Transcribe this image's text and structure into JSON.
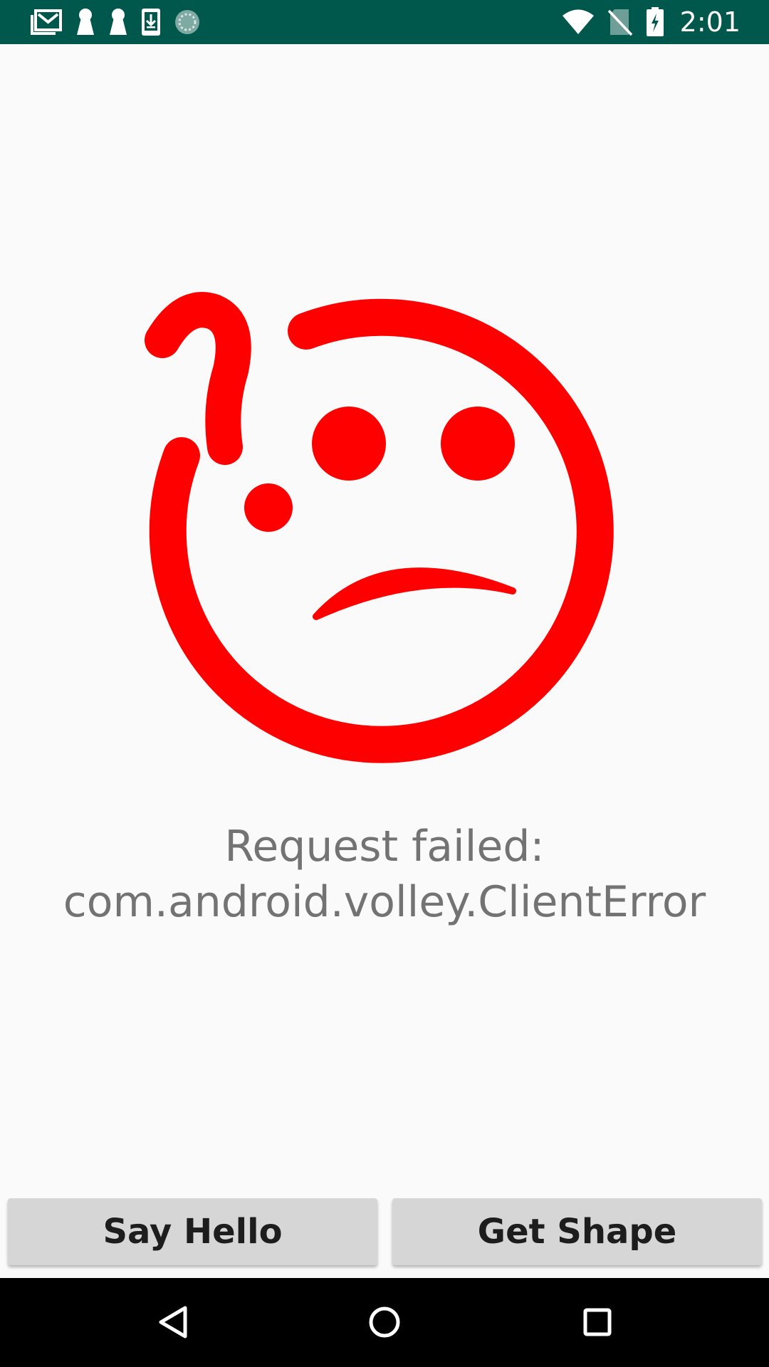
{
  "status_bar": {
    "time": "2:01",
    "left_icons": [
      "gmail-icon",
      "keyhole-icon",
      "keyhole-icon",
      "download-icon",
      "sync-icon"
    ],
    "right_icons": [
      "wifi-icon",
      "no-sim-icon",
      "battery-charging-icon"
    ],
    "background_color": "#00574b"
  },
  "main": {
    "image_icon": "confused-sad-face-icon",
    "image_color": "#ff0000",
    "message_line1": "Request failed:",
    "message_line2": "com.android.volley.ClientError",
    "message_color": "#737373"
  },
  "buttons": {
    "say_hello_label": "Say Hello",
    "get_shape_label": "Get Shape"
  },
  "nav_bar": {
    "icons": [
      "back-icon",
      "home-icon",
      "recents-icon"
    ]
  }
}
